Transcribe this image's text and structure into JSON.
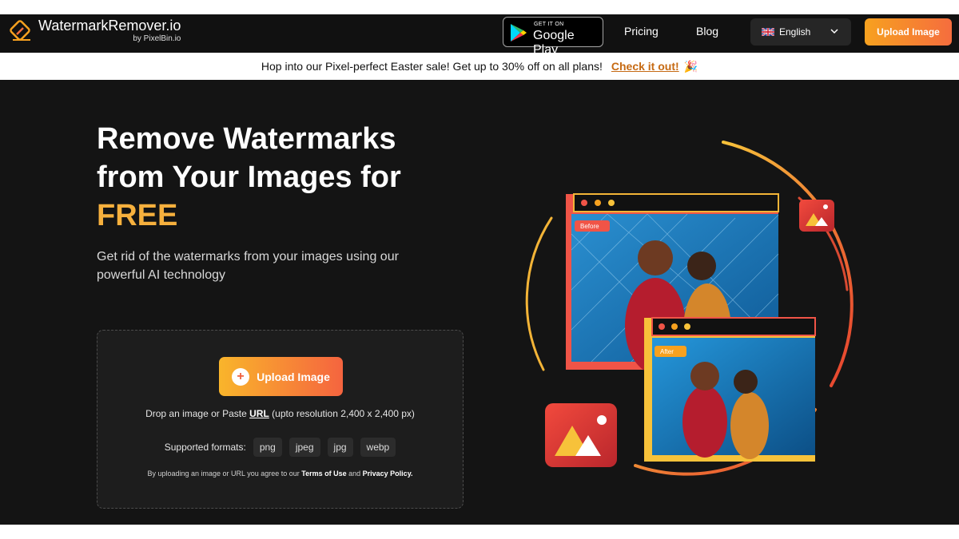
{
  "header": {
    "logo_title": "WatermarkRemover.io",
    "logo_subtitle": "by PixelBin.io",
    "google_play_small": "GET IT ON",
    "google_play_big": "Google Play",
    "nav": [
      "Pricing",
      "Blog"
    ],
    "language": "English",
    "upload_button": "Upload Image"
  },
  "banner": {
    "text": "Hop into our Pixel-perfect Easter sale! Get up to 30% off on all plans!",
    "link": "Check it out!",
    "emoji": "🎉"
  },
  "hero": {
    "title_line1": "Remove Watermarks",
    "title_line2": "from Your Images for",
    "title_highlight": "FREE",
    "subtitle": "Get rid of the watermarks from your images using our powerful AI technology"
  },
  "upload": {
    "button_label": "Upload Image",
    "drop_prefix": "Drop an image or Paste ",
    "drop_url": "URL",
    "drop_suffix": " (upto resolution 2,400 x 2,400 px)",
    "formats_label": "Supported formats:",
    "formats": [
      "png",
      "jpeg",
      "jpg",
      "webp"
    ],
    "terms_prefix": "By uploading an image or URL you agree to our ",
    "terms_link": "Terms of Use",
    "terms_and": " and ",
    "privacy_link": "Privacy Policy."
  },
  "illustration": {
    "before_label": "Before",
    "after_label": "After"
  },
  "colors": {
    "accent_orange": "#f7a11f",
    "accent_red": "#f56d3e",
    "free_highlight": "#f6b03d",
    "background": "#141414"
  }
}
